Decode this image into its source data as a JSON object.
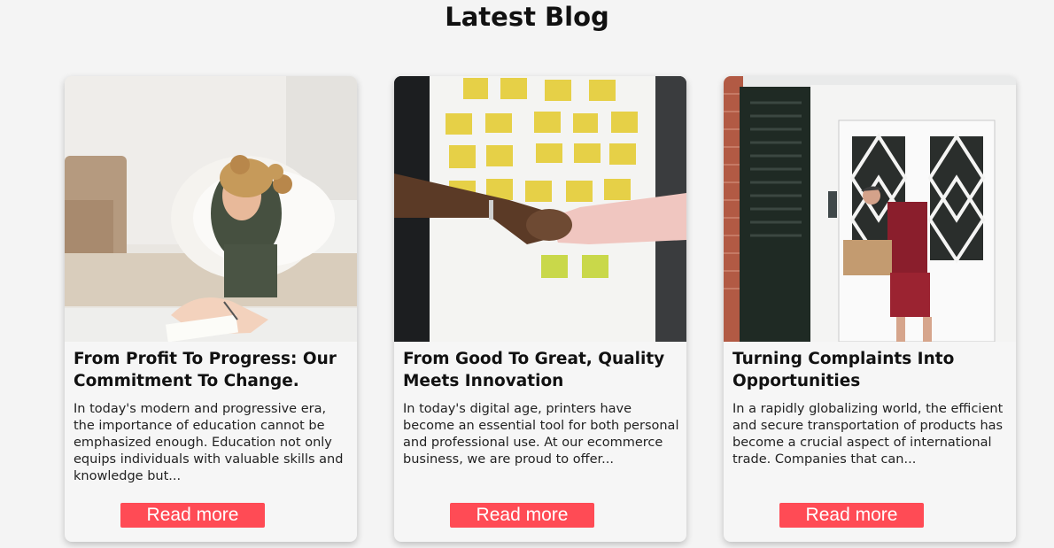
{
  "section": {
    "title": "Latest Blog"
  },
  "posts": [
    {
      "image_subject": "girl-writing-at-desk",
      "title": "From Profit To Progress: Our Commitment To Change.",
      "excerpt": "In today's modern and progressive era, the importance of education cannot be emphasized enough. Education not only equips individuals with valuable skills and knowledge but...",
      "button": "Read more"
    },
    {
      "image_subject": "handshake-in-front-of-sticky-notes",
      "title": "From Good To Great, Quality Meets Innovation",
      "excerpt": "In today's digital age, printers have become an essential tool for both personal and professional use. At our ecommerce business, we are proud to offer...",
      "button": "Read more"
    },
    {
      "image_subject": "delivery-man-at-door",
      "title": "Turning Complaints Into Opportunities",
      "excerpt": "In a rapidly globalizing world, the efficient and secure transportation of products has become a crucial aspect of international trade. Companies that can...",
      "button": "Read more"
    }
  ],
  "colors": {
    "accent": "#ff4b55",
    "background": "#f4f4f4",
    "card": "#f6f6f6"
  }
}
